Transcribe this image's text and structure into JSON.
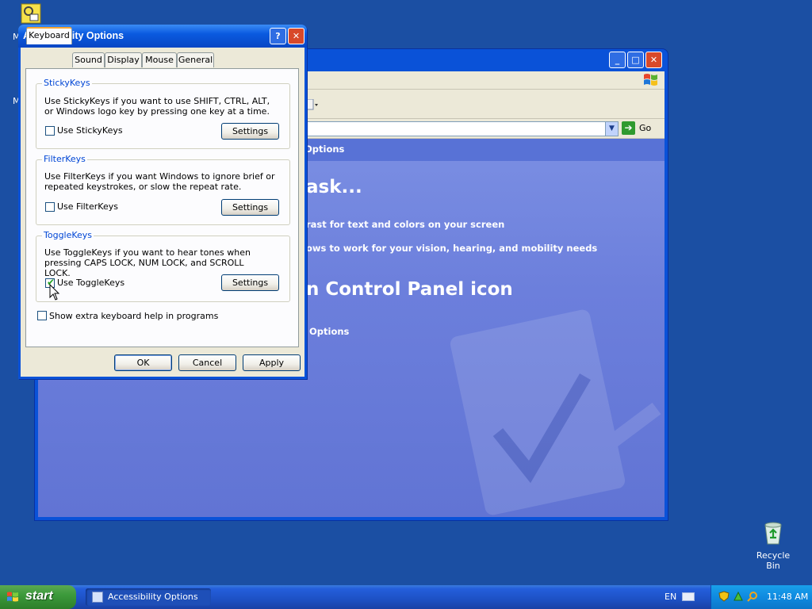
{
  "desktop": {
    "icons": [
      {
        "label": "Recycle Bin"
      }
    ],
    "partial_labels": [
      "M",
      "M"
    ]
  },
  "control_panel_window": {
    "address_go_label": "Go",
    "content_texts": {
      "breadcrumb": "Options",
      "heading1": "ask...",
      "line1": "rast for text and colors on your screen",
      "line2": "ows to work for your vision, hearing, and mobility needs",
      "heading2": "n Control Panel icon",
      "link": "Options"
    },
    "controls": {
      "minimize": "_",
      "maximize": "□",
      "close": "✕"
    }
  },
  "dialog": {
    "title": "Accessibility Options",
    "help_glyph": "?",
    "close_glyph": "✕",
    "tabs": [
      {
        "label": "Keyboard",
        "active": true
      },
      {
        "label": "Sound",
        "active": false
      },
      {
        "label": "Display",
        "active": false
      },
      {
        "label": "Mouse",
        "active": false
      },
      {
        "label": "General",
        "active": false
      }
    ],
    "groups": {
      "stickykeys": {
        "title": "StickyKeys",
        "description": "Use StickyKeys if you want to use SHIFT, CTRL, ALT, or Windows logo key by pressing one key at a time.",
        "checkbox_label": "Use StickyKeys",
        "checked": false,
        "settings_label": "Settings"
      },
      "filterkeys": {
        "title": "FilterKeys",
        "description": "Use FilterKeys if you want Windows to ignore brief or repeated keystrokes, or slow the repeat rate.",
        "checkbox_label": "Use FilterKeys",
        "checked": false,
        "settings_label": "Settings"
      },
      "togglekeys": {
        "title": "ToggleKeys",
        "description": "Use ToggleKeys if you want to hear tones when pressing CAPS LOCK, NUM LOCK, and SCROLL LOCK.",
        "checkbox_label": "Use ToggleKeys",
        "checked": true,
        "settings_label": "Settings"
      }
    },
    "extra_help": {
      "label": "Show extra keyboard help in programs",
      "checked": false
    },
    "buttons": {
      "ok": "OK",
      "cancel": "Cancel",
      "apply": "Apply"
    }
  },
  "taskbar": {
    "start_label": "start",
    "task_button_label": "Accessibility Options",
    "language": "EN",
    "clock": "11:48 AM"
  },
  "colors": {
    "desktop": "#1b4fa3",
    "titlebar": "#0a52d8",
    "groupbox_title": "#0046d5",
    "start_green": "#3c9a3c",
    "tray_blue": "#0f8ae0"
  }
}
